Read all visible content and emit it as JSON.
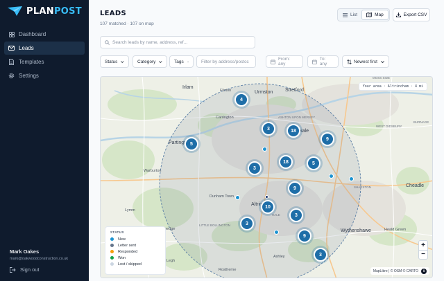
{
  "brand": {
    "part1": "PLAN",
    "part2": "POST",
    "accent_color": "#38bdf8"
  },
  "sidebar": {
    "items": [
      {
        "label": "Dashboard",
        "icon": "grid-icon"
      },
      {
        "label": "Leads",
        "icon": "envelope-icon",
        "active": true
      },
      {
        "label": "Templates",
        "icon": "document-icon"
      },
      {
        "label": "Settings",
        "icon": "gear-icon"
      }
    ],
    "user": {
      "name": "Mark Oakes",
      "email": "mark@oakwoodconstruction.co.uk"
    },
    "signout_label": "Sign out"
  },
  "header": {
    "title": "LEADS",
    "summary": "107 matched · 107 on map",
    "view_list_label": "List",
    "view_map_label": "Map",
    "active_view": "Map",
    "export_label": "Export CSV"
  },
  "search": {
    "placeholder": "Search leads by name, address, ref...",
    "value": ""
  },
  "filters": {
    "status_label": "Status",
    "category_label": "Category",
    "tags_label": "Tags",
    "address_placeholder": "Filter by address/postcc",
    "from_label": "From: any",
    "to_label": "To: any",
    "sort_label": "Newest first"
  },
  "map": {
    "area_badge": "Your area · Altrincham · 4 mi",
    "places": [
      {
        "label": "Irlam",
        "cls": "big"
      },
      {
        "label": "Flixton",
        "cls": ""
      },
      {
        "label": "Urmston",
        "cls": "big"
      },
      {
        "label": "Stretford",
        "cls": "big"
      },
      {
        "label": "MOSS SIDE",
        "cls": "tiny"
      },
      {
        "label": "Carrington",
        "cls": ""
      },
      {
        "label": "ASHTON UPON MERSEY",
        "cls": "tiny"
      },
      {
        "label": "Sale",
        "cls": "big"
      },
      {
        "label": "WEST DIDSBURY",
        "cls": "tiny"
      },
      {
        "label": "BURNAGE",
        "cls": "tiny"
      },
      {
        "label": "Partington",
        "cls": "big"
      },
      {
        "label": "Warburton",
        "cls": ""
      },
      {
        "label": "SHARSTON",
        "cls": "tiny"
      },
      {
        "label": "Cheadle",
        "cls": "big"
      },
      {
        "label": "Dunham Town",
        "cls": ""
      },
      {
        "label": "Altrincham",
        "cls": "big"
      },
      {
        "label": "HALE",
        "cls": "tiny"
      },
      {
        "label": "Wythenshawe",
        "cls": "big"
      },
      {
        "label": "Lymm",
        "cls": ""
      },
      {
        "label": "LITTLE BOLLINGTON",
        "cls": "tiny"
      },
      {
        "label": "Broomedge",
        "cls": ""
      },
      {
        "label": "Heald Green",
        "cls": ""
      },
      {
        "label": "High Legh",
        "cls": ""
      },
      {
        "label": "Ashley",
        "cls": ""
      },
      {
        "label": "Rostherne",
        "cls": ""
      }
    ],
    "clusters": [
      "4",
      "3",
      "18",
      "9",
      "5",
      "3",
      "18",
      "5",
      "9",
      "10",
      "3",
      "3",
      "9",
      "3"
    ],
    "points": [
      {
        "kind": "light"
      },
      {
        "kind": "light"
      },
      {
        "kind": "light"
      },
      {
        "kind": "light"
      },
      {
        "kind": "dark"
      },
      {
        "kind": "light"
      }
    ],
    "legend": {
      "title": "STATUS",
      "items": [
        {
          "label": "New",
          "color": "#1c93d1"
        },
        {
          "label": "Letter sent",
          "color": "#64748b"
        },
        {
          "label": "Responded",
          "color": "#f59e0b"
        },
        {
          "label": "Won",
          "color": "#16a34a"
        },
        {
          "label": "Lost / skipped",
          "color": "#cbd5e1"
        }
      ]
    },
    "zoom_in": "+",
    "zoom_out": "−",
    "attribution": "MapLibre | © OSM © CARTO",
    "info_glyph": "i"
  }
}
